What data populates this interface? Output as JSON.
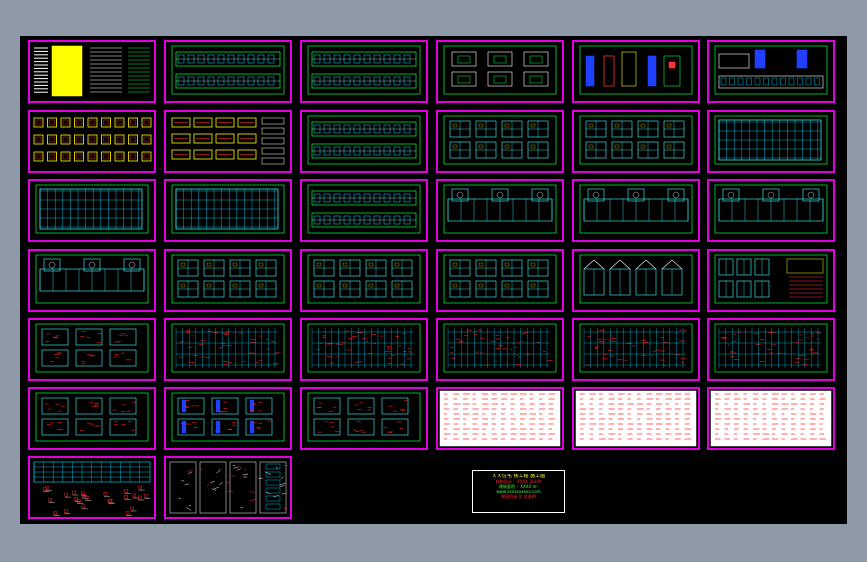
{
  "window": {
    "background": "#8f9aa9"
  },
  "canvas": {
    "background": "#000000",
    "sheet_border_color": "#e000e0"
  },
  "colors": {
    "grid": "#00ff40",
    "plan_lines": "#00e0ff",
    "room_lines": "#40ffff",
    "rebar": "#ff2020",
    "highlight": "#ffff00",
    "magenta": "#e000e0",
    "white": "#ffffff"
  },
  "sheets": [
    {
      "row": 0,
      "col": 0,
      "kind": "notes"
    },
    {
      "row": 0,
      "col": 1,
      "kind": "elevation"
    },
    {
      "row": 0,
      "col": 2,
      "kind": "elevation"
    },
    {
      "row": 0,
      "col": 3,
      "kind": "section"
    },
    {
      "row": 0,
      "col": 4,
      "kind": "detail_color"
    },
    {
      "row": 0,
      "col": 5,
      "kind": "elevation_blue"
    },
    {
      "row": 1,
      "col": 0,
      "kind": "details_yellow"
    },
    {
      "row": 1,
      "col": 1,
      "kind": "details_yellow2"
    },
    {
      "row": 1,
      "col": 2,
      "kind": "elevation"
    },
    {
      "row": 1,
      "col": 3,
      "kind": "units"
    },
    {
      "row": 1,
      "col": 4,
      "kind": "units"
    },
    {
      "row": 1,
      "col": 5,
      "kind": "grid_plan"
    },
    {
      "row": 2,
      "col": 0,
      "kind": "grid_plan"
    },
    {
      "row": 2,
      "col": 1,
      "kind": "grid_plan"
    },
    {
      "row": 2,
      "col": 2,
      "kind": "elevation"
    },
    {
      "row": 2,
      "col": 3,
      "kind": "floor_plan"
    },
    {
      "row": 2,
      "col": 4,
      "kind": "floor_plan"
    },
    {
      "row": 2,
      "col": 5,
      "kind": "floor_plan"
    },
    {
      "row": 3,
      "col": 0,
      "kind": "floor_plan"
    },
    {
      "row": 3,
      "col": 1,
      "kind": "units"
    },
    {
      "row": 3,
      "col": 2,
      "kind": "units"
    },
    {
      "row": 3,
      "col": 3,
      "kind": "units"
    },
    {
      "row": 3,
      "col": 4,
      "kind": "roof"
    },
    {
      "row": 3,
      "col": 5,
      "kind": "units_notes"
    },
    {
      "row": 4,
      "col": 0,
      "kind": "struct_units"
    },
    {
      "row": 4,
      "col": 1,
      "kind": "struct_plan"
    },
    {
      "row": 4,
      "col": 2,
      "kind": "struct_plan"
    },
    {
      "row": 4,
      "col": 3,
      "kind": "struct_plan"
    },
    {
      "row": 4,
      "col": 4,
      "kind": "struct_plan"
    },
    {
      "row": 4,
      "col": 5,
      "kind": "struct_plan"
    },
    {
      "row": 5,
      "col": 0,
      "kind": "struct_units"
    },
    {
      "row": 5,
      "col": 1,
      "kind": "struct_units_blue"
    },
    {
      "row": 5,
      "col": 2,
      "kind": "struct_units"
    },
    {
      "row": 5,
      "col": 3,
      "kind": "table_white"
    },
    {
      "row": 5,
      "col": 4,
      "kind": "table_white"
    },
    {
      "row": 5,
      "col": 5,
      "kind": "table_white"
    },
    {
      "row": 6,
      "col": 0,
      "kind": "grid_details"
    },
    {
      "row": 6,
      "col": 1,
      "kind": "details_mixed"
    }
  ],
  "title_block": {
    "line1": "ＸＸ住宅 楼工程 施工图",
    "line2": "结构设计 ：XXXX 设计院",
    "line3": "建筑面积 ：XXXX m²",
    "line4": "www.xxxxxxxxxx.com",
    "line5": "图纸目录 及 总说明"
  }
}
